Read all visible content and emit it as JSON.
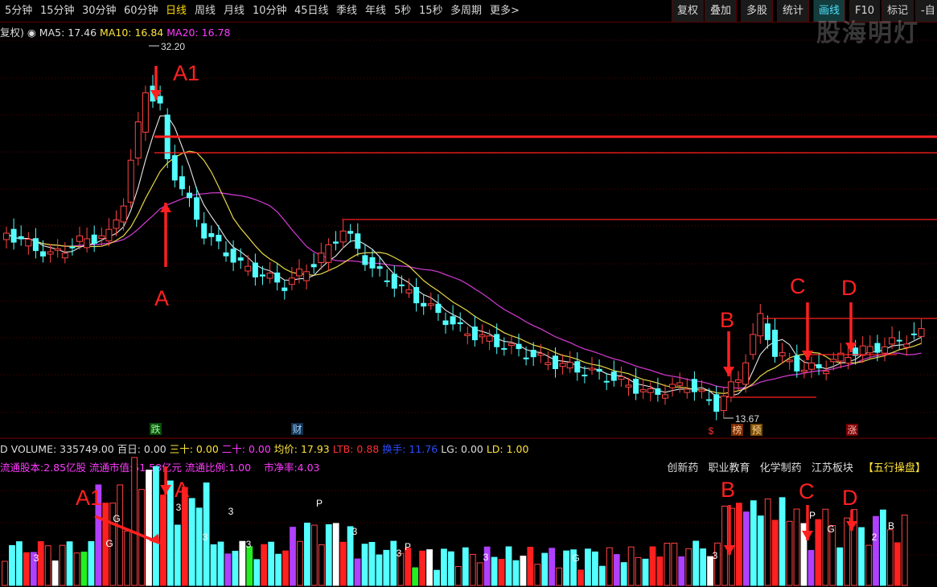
{
  "toolbar": {
    "left_items": [
      "5分钟",
      "15分钟",
      "30分钟",
      "60分钟",
      "日线",
      "周线",
      "月线",
      "10分钟",
      "45日线",
      "季线",
      "年线",
      "5秒",
      "15秒",
      "多周期",
      "更多>"
    ],
    "active": "日线",
    "right_items": [
      "复权",
      "叠加",
      "多股",
      "统计",
      "画线",
      "F10",
      "标记",
      "-自"
    ],
    "highlight": "画线"
  },
  "watermark": "股海明灯",
  "price_info": {
    "prefix": "复权)",
    "ma5": "MA5: 17.46",
    "ma10": "MA10: 16.84",
    "ma20": "MA20: 16.78"
  },
  "price_marks": {
    "high": "32.20",
    "low": "13.67"
  },
  "annotations": {
    "a1": "A1",
    "a": "A",
    "b": "B",
    "c": "C",
    "d": "D"
  },
  "event_tags": {
    "die": "跌",
    "cai": "财",
    "dollar": "$",
    "bang": "榜",
    "yu": "预",
    "zhang": "涨"
  },
  "volume_info": {
    "prefix": "D",
    "volume": "VOLUME: 335749.00",
    "bairi": "百日: 0.00",
    "sanshi": "三十: 0.00",
    "ershi": "二十: 0.00",
    "junjia": "均价: 17.93",
    "ltb": "LTB: 0.88",
    "huanshou": "换手: 11.76",
    "lg": "LG: 0.00",
    "ld": "LD: 1.00"
  },
  "float_info": {
    "shares": "流通股本:2.85亿股",
    "mktcap": "流通市值:51.58亿元",
    "ratio": "流通比例:1.00",
    "pb": "市净率:4.03"
  },
  "concepts": [
    "创新药",
    "职业教育",
    "化学制药",
    "江苏板块",
    "【五行操盘】"
  ],
  "vol_marks": [
    "3",
    "G",
    "G",
    "3",
    "3",
    "3",
    "3",
    "P",
    "3",
    "3",
    "P",
    "3",
    "G",
    "3",
    "P",
    "G",
    "2",
    "B"
  ],
  "colors": {
    "up": "#ff4444",
    "down": "#54ffff",
    "ma5": "#e8e8e8",
    "ma10": "#e8d846",
    "ma20": "#c838c8",
    "line": "#ff2020"
  }
}
